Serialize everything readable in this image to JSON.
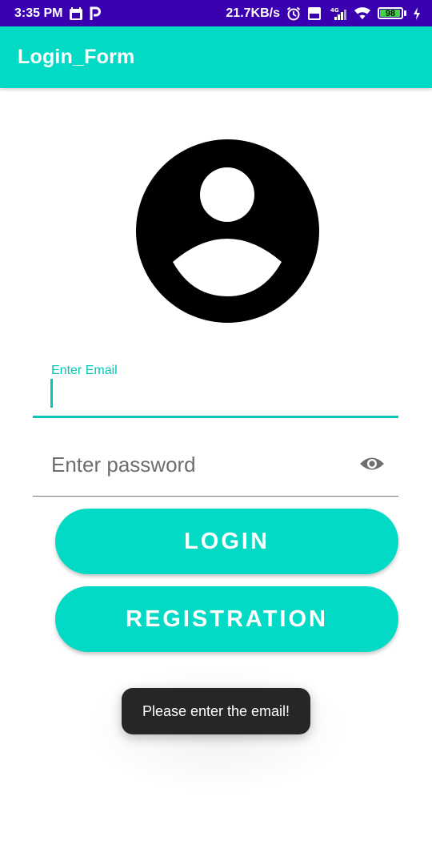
{
  "status_bar": {
    "time": "3:35 PM",
    "network_speed": "21.7KB/s",
    "network_type": "4G",
    "battery_level": "98",
    "icons": [
      "calendar-icon",
      "p-app-icon",
      "alarm-icon",
      "volte-icon",
      "signal-icon",
      "wifi-icon",
      "battery-icon",
      "charging-icon"
    ]
  },
  "app_bar": {
    "title": "Login_Form"
  },
  "avatar": {
    "icon": "account-circle-icon"
  },
  "form": {
    "email": {
      "label": "Enter Email",
      "value": ""
    },
    "password": {
      "placeholder": "Enter password",
      "toggle_icon": "eye-icon"
    },
    "login_button": "LOGIN",
    "registration_button": "REGISTRATION"
  },
  "toast": {
    "message": "Please enter the email!"
  },
  "colors": {
    "status_bar": "#3a00b0",
    "primary": "#03dac5",
    "accent_text": "#03c7b7",
    "toast_bg": "#262626"
  }
}
